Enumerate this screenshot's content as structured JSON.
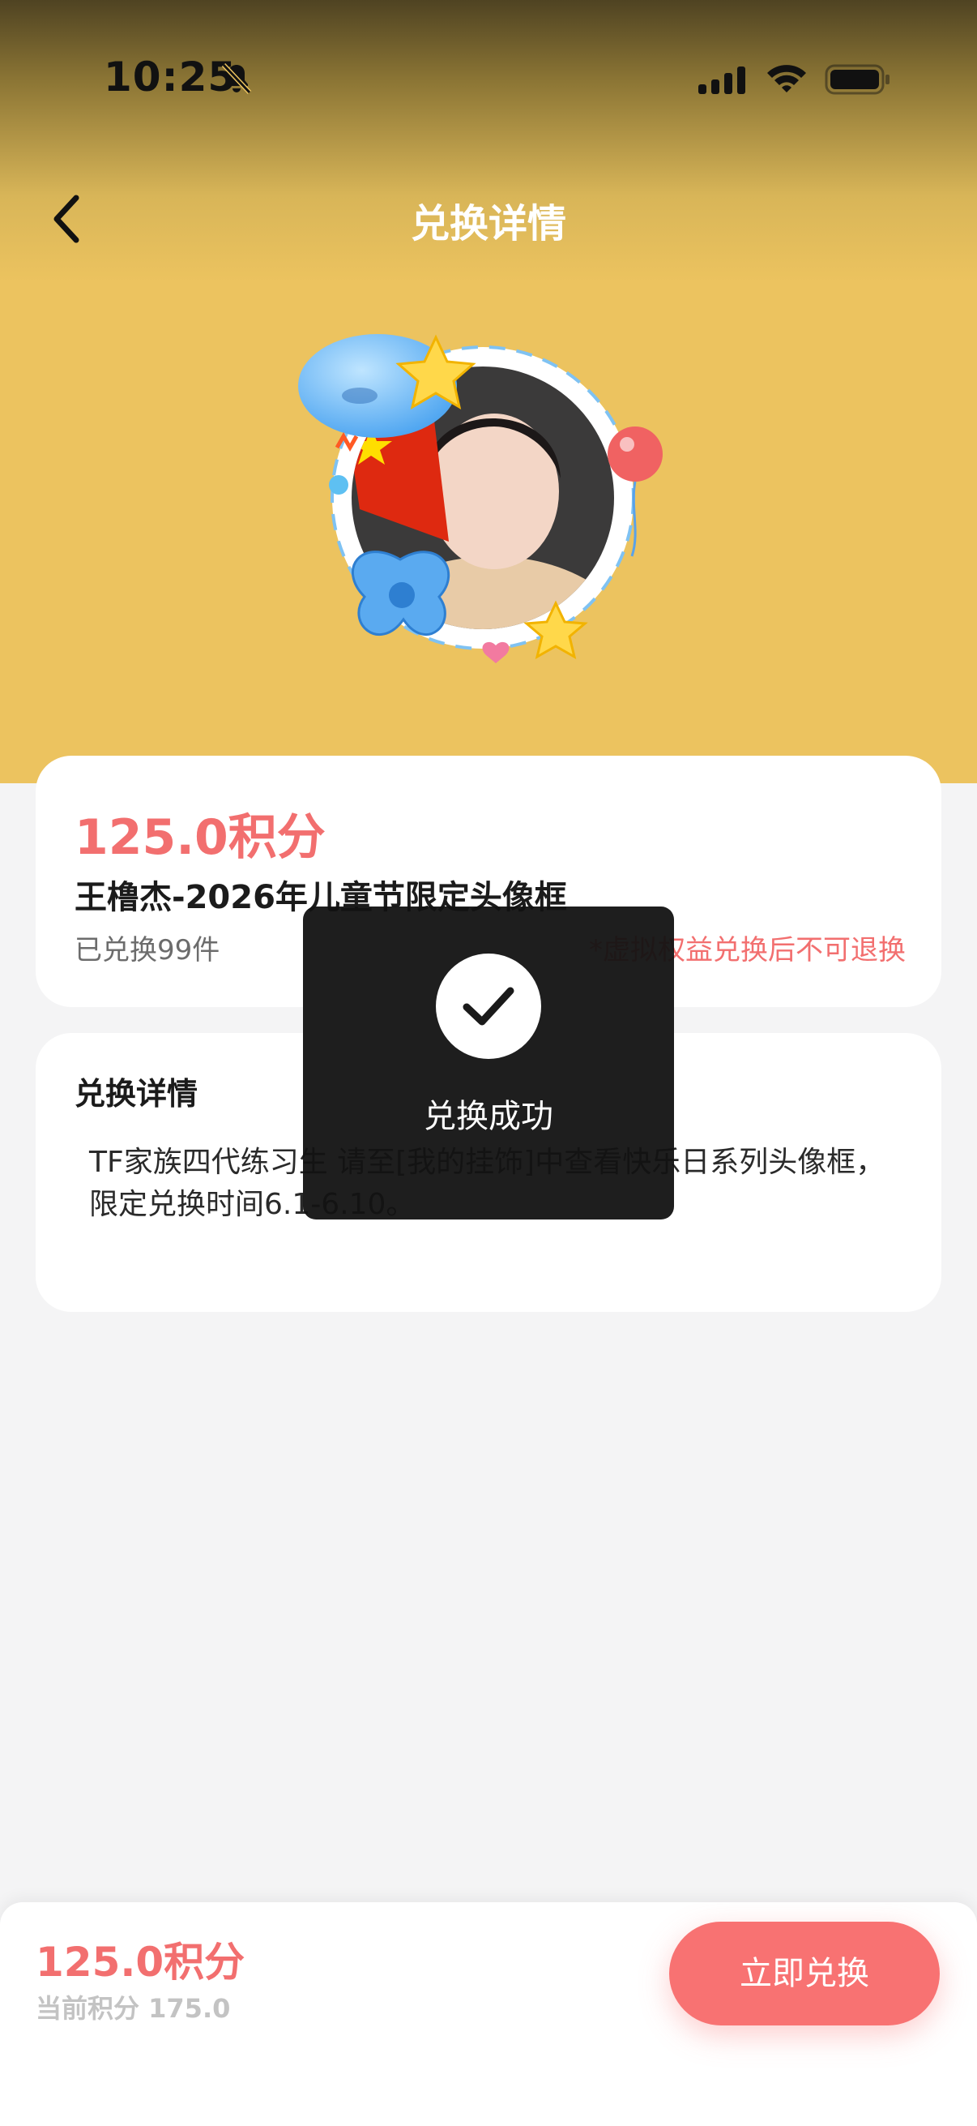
{
  "status_bar": {
    "time": "10:25",
    "icons": [
      "bell-slash-icon",
      "signal-icon",
      "wifi-icon",
      "battery-icon"
    ]
  },
  "nav": {
    "title": "兑换详情",
    "back_icon": "chevron-left-icon"
  },
  "product": {
    "price": "125.0积分",
    "title": "王橹杰-2026年儿童节限定头像框",
    "sold": "已兑换99件",
    "notice": "*虚拟权益兑换后不可退换"
  },
  "detail": {
    "heading": "兑换详情",
    "text": "TF家族四代练习生 请至[我的挂饰]中查看快乐日系列头像框，限定兑换时间6.1-6.10。"
  },
  "toast": {
    "message": "兑换成功",
    "icon": "check-icon"
  },
  "footer": {
    "price": "125.0积分",
    "balance": "当前积分 175.0",
    "button": "立即兑换"
  },
  "colors": {
    "accent": "#f87272",
    "price_text": "#f26f6f",
    "header_yellow": "#ecc35f",
    "page_bg": "#f4f4f5"
  }
}
